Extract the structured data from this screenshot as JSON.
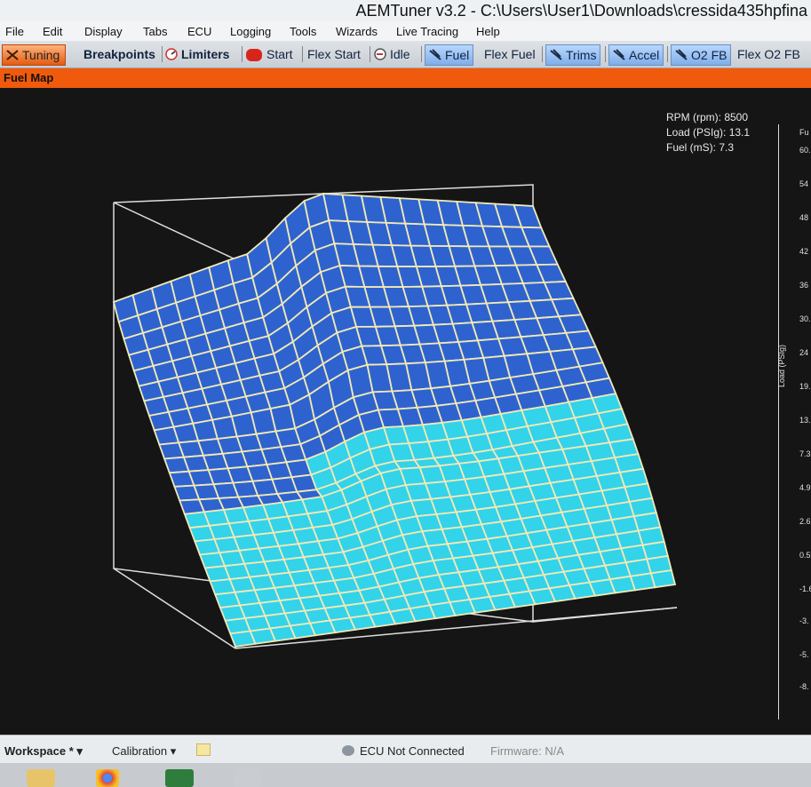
{
  "window": {
    "title": "AEMTuner v3.2 - C:\\Users\\User1\\Downloads\\cressida435hpfina"
  },
  "menu": [
    "File",
    "Edit",
    "Display",
    "Tabs",
    "ECU",
    "Logging",
    "Tools",
    "Wizards",
    "Live Tracing",
    "Help"
  ],
  "tabs": [
    "Tuning",
    "Breakpoints",
    "Limiters",
    "Start",
    "Flex Start",
    "Idle",
    "Fuel",
    "Flex Fuel",
    "Trims",
    "Accel",
    "O2 FB",
    "Flex O2 FB"
  ],
  "panel": {
    "title": "Fuel Map"
  },
  "readout": {
    "rpm": "RPM (rpm): 8500",
    "load": "Load (PSIg): 13.1",
    "fuel": "Fuel (mS): 7.3"
  },
  "scale": {
    "header": "Fu",
    "label": "Load (PSIg)",
    "ticks": [
      "60.",
      "54",
      "48",
      "42",
      "36",
      "30.",
      "24",
      "19.",
      "13.",
      "7.3",
      "4.9",
      "2.6",
      "0.5",
      "-1.6",
      "-3.",
      "-5.",
      "-8."
    ]
  },
  "status": {
    "workspace": "Workspace *",
    "calibration": "Calibration",
    "connection": "ECU Not Connected",
    "firmware": "Firmware: N/A"
  },
  "colors": {
    "accent": "#f05a0c",
    "surface_dark": "#2e63cf",
    "surface_light": "#33d3ea",
    "grid": "#f2e9b6"
  }
}
